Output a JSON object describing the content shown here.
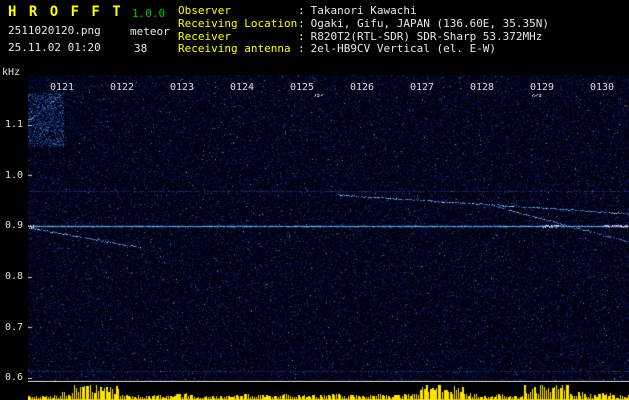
{
  "colors": {
    "background": "#000000",
    "title_yellow": "#ffff00",
    "version_green": "#00c800",
    "text_white": "#e8e8e8",
    "carrier_cyan": "#9be0ff",
    "meteor_pink": "#ff8cd2",
    "noise_blue": "#10307a",
    "bar_yellow": "#ffe400"
  },
  "header": {
    "title": "H R O F F T",
    "version": "1.0.0",
    "filename": "2511020120.png",
    "mode": "meteor",
    "datetime": "25.11.02 01:20",
    "count": "38",
    "colon": ":"
  },
  "info": {
    "rows": [
      {
        "label": "Observer",
        "value": "Takanori Kawachi"
      },
      {
        "label": "Receiving Location",
        "value": "Ogaki, Gifu, JAPAN (136.60E, 35.35N)"
      },
      {
        "label": "Receiver",
        "value": "R820T2(RTL-SDR) SDR-Sharp 53.372MHz"
      },
      {
        "label": "Receiving antenna",
        "value": "2el-HB9CV Vertical (el. E-W)"
      }
    ]
  },
  "chart_data": {
    "type": "heatmap",
    "title": "HROFFT radio meteor observation spectrogram 0120-0130",
    "y_axis": {
      "label": "kHz",
      "tick_labels": [
        "1.1",
        "1.0",
        "0.9",
        "0.8",
        "0.7",
        "0.6"
      ],
      "tick_values": [
        1.1,
        1.0,
        0.9,
        0.8,
        0.7,
        0.6
      ],
      "range": [
        0.6,
        1.2
      ]
    },
    "x_axis": {
      "tick_labels": [
        "0121",
        "0122",
        "0123",
        "0124",
        "0125",
        "0126",
        "0127",
        "0128",
        "0129",
        "0130"
      ],
      "unit": "hhmm"
    },
    "carrier_line_khz": 0.9,
    "faint_lines_khz": [
      0.97,
      0.613
    ],
    "streaks": [
      {
        "name": "echo-top-left",
        "t1": 0.2,
        "f1": 1.085,
        "t2": 0.98,
        "f2": 1.16
      },
      {
        "name": "echo-left-descending",
        "t1": 0.45,
        "f1": 0.897,
        "t2": 2.3,
        "f2": 0.858
      },
      {
        "name": "echo-long-shallow",
        "t1": 5.6,
        "f1": 0.962,
        "t2": 10.45,
        "f2": 0.925
      },
      {
        "name": "echo-right-descending",
        "t1": 8.2,
        "f1": 0.94,
        "t2": 10.45,
        "f2": 0.869
      }
    ],
    "spots": [
      {
        "t": 0.45,
        "f": 0.9
      },
      {
        "t": 5.27,
        "f": 1.158
      },
      {
        "t": 8.9,
        "f": 1.158
      },
      {
        "t": 9.05,
        "f": 0.9
      },
      {
        "t": 9.2,
        "f": 0.9
      },
      {
        "t": 10.1,
        "f": 0.9
      },
      {
        "t": 10.25,
        "f": 0.9
      },
      {
        "t": 10.4,
        "f": 0.9
      }
    ],
    "signal_bars": {
      "color": "#ffe400",
      "envelope": [
        0.25,
        0.3,
        0.45,
        0.95,
        1.0,
        0.8,
        0.35,
        0.3,
        0.3,
        0.35,
        0.4,
        0.3,
        0.25,
        0.3,
        0.35,
        0.3,
        0.3,
        0.35,
        0.3,
        0.3,
        0.35,
        0.3,
        0.4,
        0.35,
        0.3,
        0.45,
        0.9,
        1.0,
        0.85,
        0.4,
        0.3,
        0.35,
        0.3,
        0.85,
        1.0,
        0.9,
        0.45,
        0.35,
        0.4,
        0.3
      ]
    }
  }
}
